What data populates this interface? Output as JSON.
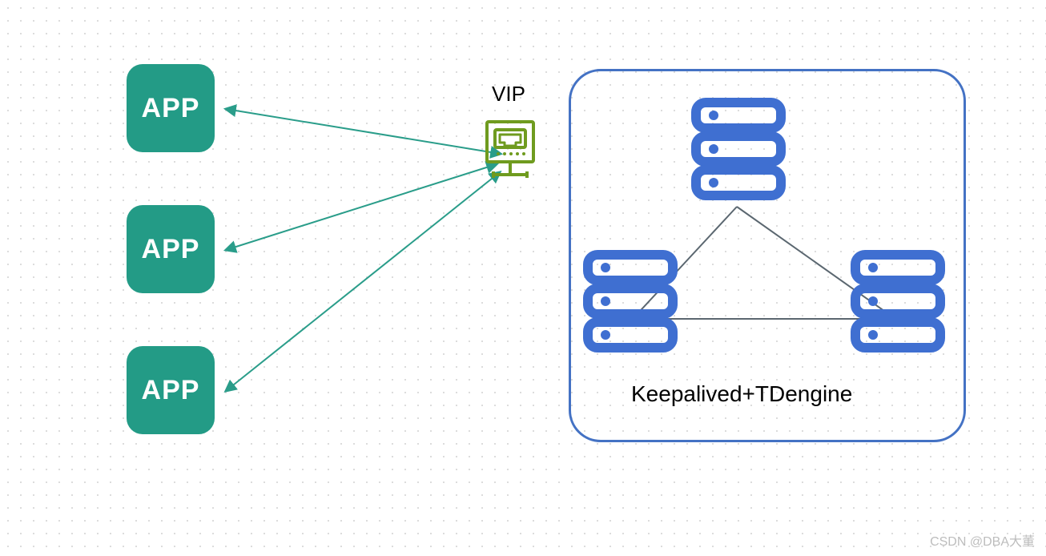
{
  "apps": {
    "box1_label": "APP",
    "box2_label": "APP",
    "box3_label": "APP"
  },
  "vip": {
    "label": "VIP"
  },
  "cluster": {
    "label": "Keepalived+TDengine",
    "nodes": 3
  },
  "colors": {
    "app_fill": "#239b86",
    "arrow": "#2a9d8a",
    "cluster_border": "#4472c4",
    "server_blue": "#3f6fd1",
    "vip_icon": "#6f9b1f",
    "triangle": "#5b6770"
  },
  "watermark": "CSDN @DBA大董"
}
